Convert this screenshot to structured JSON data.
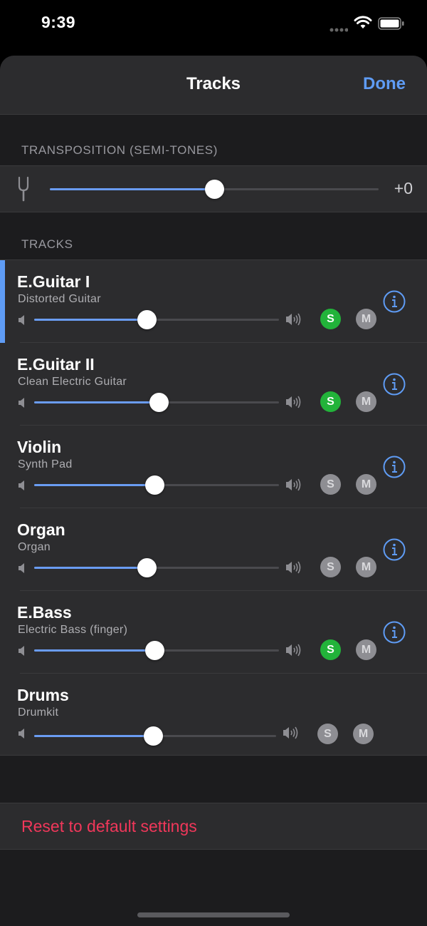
{
  "status": {
    "time": "9:39"
  },
  "nav": {
    "title": "Tracks",
    "done_label": "Done"
  },
  "transposition": {
    "header": "TRANSPOSITION (SEMI-TONES)",
    "value_label": "+0",
    "slider_fraction": 0.5
  },
  "tracks_header": "TRACKS",
  "tracks": [
    {
      "name": "E.Guitar I",
      "instrument": "Distorted Guitar",
      "volume": 0.46,
      "solo": true,
      "solo_label": "S",
      "mute_label": "M",
      "selected": true,
      "has_info": true
    },
    {
      "name": "E.Guitar II",
      "instrument": "Clean Electric Guitar",
      "volume": 0.51,
      "solo": true,
      "solo_label": "S",
      "mute_label": "M",
      "selected": false,
      "has_info": true
    },
    {
      "name": "Violin",
      "instrument": "Synth Pad",
      "volume": 0.49,
      "solo": false,
      "solo_label": "S",
      "mute_label": "M",
      "selected": false,
      "has_info": true
    },
    {
      "name": "Organ",
      "instrument": "Organ",
      "volume": 0.46,
      "solo": false,
      "solo_label": "S",
      "mute_label": "M",
      "selected": false,
      "has_info": true
    },
    {
      "name": "E.Bass",
      "instrument": "Electric Bass (finger)",
      "volume": 0.49,
      "solo": true,
      "solo_label": "S",
      "mute_label": "M",
      "selected": false,
      "has_info": true
    },
    {
      "name": "Drums",
      "instrument": "Drumkit",
      "volume": 0.49,
      "solo": false,
      "solo_label": "S",
      "mute_label": "M",
      "selected": false,
      "has_info": false
    }
  ],
  "reset_label": "Reset to default settings",
  "icons": {
    "status": [
      "signal-dots-icon",
      "wifi-icon",
      "battery-icon"
    ],
    "transposition": "tuning-fork-icon",
    "track": [
      "volume-min-icon",
      "volume-max-icon",
      "info-icon"
    ]
  },
  "colors": {
    "accent": "#5f9cf5",
    "solo_on": "#22b33a",
    "destructive": "#f0375a"
  }
}
